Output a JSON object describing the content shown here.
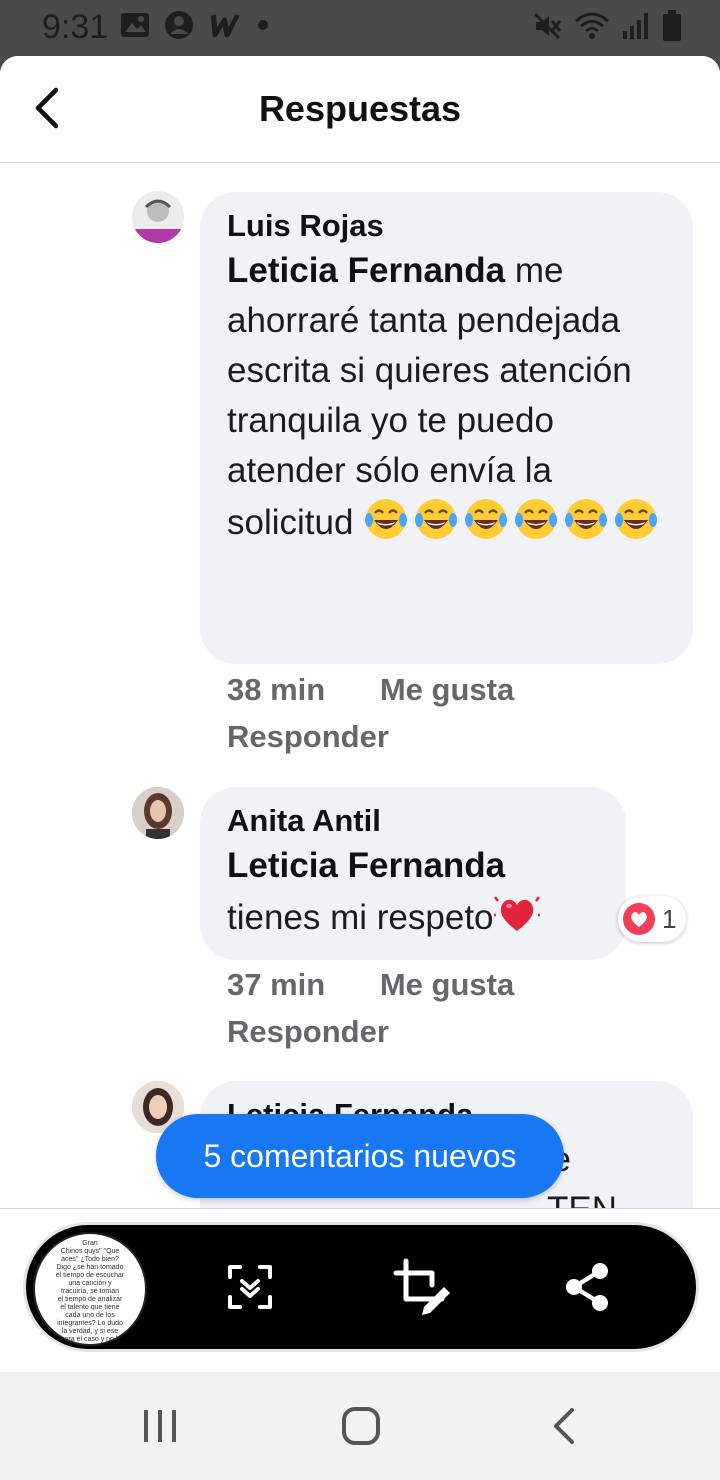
{
  "status_bar": {
    "time": "9:31",
    "left_icons": [
      "image-icon",
      "account-circle-icon",
      "w-app-icon",
      "dot-icon"
    ],
    "right_icons": [
      "mute-icon",
      "wifi-icon",
      "signal-icon",
      "battery-icon"
    ]
  },
  "header": {
    "title": "Respuestas",
    "back_icon": "chevron-left-icon"
  },
  "comments": [
    {
      "author": "Luis Rojas",
      "mention": "Leticia Fernanda",
      "text": " me ahorraré tanta pendejada escrita si quieres atención tranquila yo te puedo atender sólo envía la solicitud ",
      "emoji": "face-with-tears-of-joy-icon",
      "emoji_count": 6,
      "time": "38 min",
      "like_label": "Me gusta",
      "reply_label": "Responder"
    },
    {
      "author": "Anita Antil",
      "mention": "Leticia Fernanda",
      "text": "tienes mi respeto",
      "emoji": "beating-heart-icon",
      "emoji_count": 1,
      "reaction_icon": "love-reaction-icon",
      "reaction_count": "1",
      "time": "37 min",
      "like_label": "Me gusta",
      "reply_label": "Responder"
    },
    {
      "author": "Leticia Fernanda",
      "partial_line": "e",
      "partial_line_2": "TEN"
    }
  ],
  "new_comments_label": "5 comentarios nuevos",
  "capture_toolbar": {
    "thumbnail_lines": [
      "Gran",
      "Chinos quys\" \"Que",
      "aces\" ¿Todo bien?",
      "Digo ¿se han tomado",
      "el tiempo de escuchar",
      "una canción y",
      "tracuiría, se toman",
      "el tiempo de analizar",
      "el talento que tiene",
      "cada uno de los",
      "integrantes? Lo dudo",
      "la verdad, y si ese",
      "fuera el caso y no le",
      "no creen que"
    ],
    "tools": [
      "scroll-capture-icon",
      "crop-edit-icon",
      "share-icon"
    ]
  },
  "nav_bar": {
    "buttons": [
      "recents-icon",
      "home-icon",
      "back-icon"
    ]
  },
  "colors": {
    "accent": "#1877f2",
    "bubble": "#f0f2f5",
    "meta": "#65676b",
    "love_reaction": "#f33e58"
  }
}
